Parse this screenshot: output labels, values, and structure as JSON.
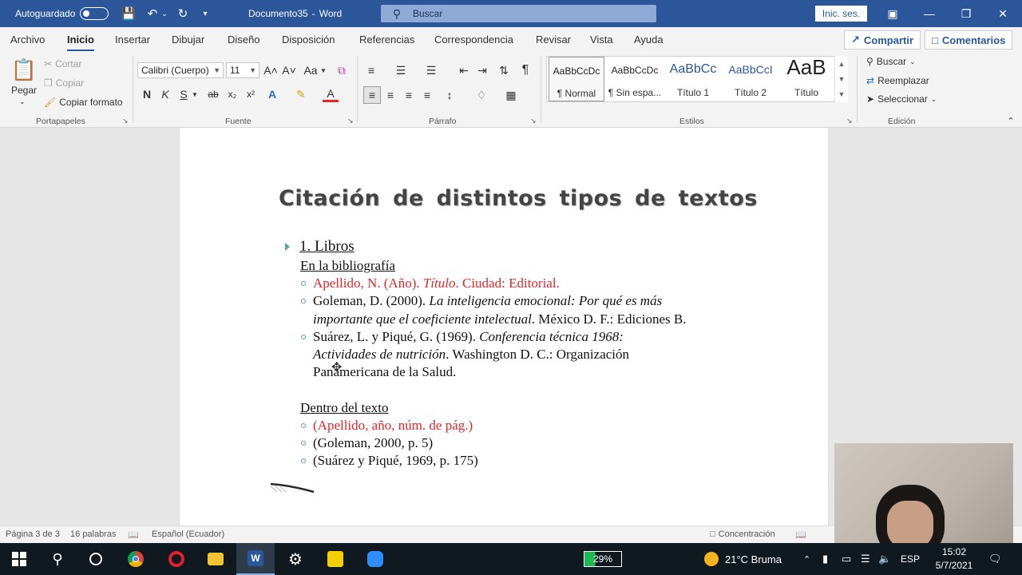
{
  "titlebar": {
    "autosave_label": "Autoguardado",
    "document_name": "Documento35",
    "separator": "-",
    "app_name": "Word",
    "search_placeholder": "Buscar",
    "signin_label": "Inic. ses.",
    "background_color": "#2b579a"
  },
  "ribbon": {
    "tabs": [
      "Archivo",
      "Inicio",
      "Insertar",
      "Dibujar",
      "Diseño",
      "Disposición",
      "Referencias",
      "Correspondencia",
      "Revisar",
      "Vista",
      "Ayuda"
    ],
    "active_tab": "Inicio",
    "share_label": "Compartir",
    "comments_label": "Comentarios",
    "clipboard": {
      "paste_label": "Pegar",
      "cut_label": "Cortar",
      "copy_label": "Copiar",
      "format_painter_label": "Copiar formato",
      "group_label": "Portapapeles"
    },
    "font": {
      "font_name": "Calibri (Cuerpo)",
      "font_size": "11",
      "grow_label": "A˄",
      "shrink_label": "A˅",
      "case_label": "Aa",
      "bold_label": "N",
      "italic_label": "K",
      "underline_label": "S",
      "strike_label": "ab",
      "subscript_label": "x₂",
      "superscript_label": "x²",
      "color_label": "A",
      "group_label": "Fuente"
    },
    "paragraph": {
      "group_label": "Párrafo",
      "pilcrow": "¶"
    },
    "styles": {
      "items": [
        {
          "sample": "AaBbCcDc",
          "name": "¶ Normal"
        },
        {
          "sample": "AaBbCcDc",
          "name": "¶ Sin espa..."
        },
        {
          "sample": "AaBbCc",
          "name": "Título 1"
        },
        {
          "sample": "AaBbCcI",
          "name": "Título 2"
        },
        {
          "sample": "AaB",
          "name": "Título"
        }
      ],
      "group_label": "Estilos"
    },
    "editing": {
      "find_label": "Buscar",
      "replace_label": "Reemplazar",
      "select_label": "Seleccionar",
      "group_label": "Edición"
    }
  },
  "document": {
    "title": "Citación de distintos tipos de textos",
    "section_heading": "1. Libros",
    "bibliography_heading": "En la bibliografía",
    "bib_template": {
      "a": "Apellido, N. (Año). ",
      "b": "Título",
      "c": ". Ciudad: Editorial."
    },
    "bib_goleman": {
      "a": "Goleman, D. (2000). ",
      "b": "La inteligencia emocional: Por qué es más",
      "c": "importante que el coeficiente intelectual",
      "d": ". México D. F.: Ediciones B."
    },
    "bib_suarez": {
      "a": "Suárez, L. y Piqué, G. (1969). ",
      "b": "Conferencia técnica 1968:",
      "c": "Actividades de nutrición",
      "d": ". Washington D. C.: Organización",
      "e": "Panamericana de la Salud."
    },
    "in_text_heading": "Dentro del texto",
    "in_text_template": "(Apellido, año, núm. de pág.)",
    "in_text_goleman": "(Goleman, 2000, p. 5)",
    "in_text_suarez": "(Suárez y Piqué, 1969, p. 175)",
    "accent_color": "#e3262a",
    "bullet_color": "#5aa0b8"
  },
  "statusbar": {
    "page": "Página 3 de 3",
    "words": "16 palabras",
    "language": "Español (Ecuador)",
    "focus": "Concentración"
  },
  "taskbar": {
    "battery": "29%",
    "weather": "21°C Bruma",
    "keyboard": "ESP",
    "time": "15:02",
    "date": "5/7/2021"
  }
}
